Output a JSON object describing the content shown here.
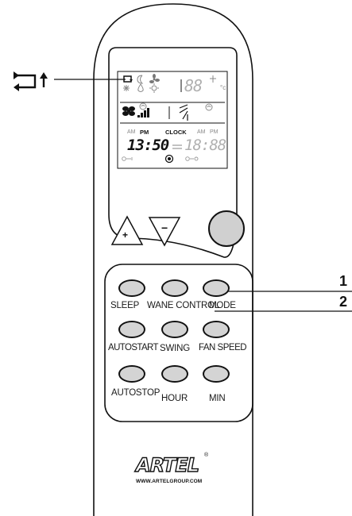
{
  "display": {
    "clock_label": "CLOCK",
    "am_left": "AM",
    "pm_left": "PM",
    "am_right": "AM",
    "pm_right": "PM",
    "clock_time": "13:50",
    "timer_time": "18:88",
    "temp_digits": "88",
    "degree_unit": "°c"
  },
  "buttons": {
    "up_symbol": "+",
    "down_symbol": "−",
    "row1": [
      "SLEEP",
      "WANE CONTROL",
      "MODE"
    ],
    "row2": [
      "AUTOSTART",
      "SWING",
      "FAN SPEED"
    ],
    "row3": [
      "AUTOSTOP",
      "HOUR",
      "MIN"
    ]
  },
  "callouts": [
    "1",
    "2"
  ],
  "brand": {
    "name": "ARTEL",
    "registered": "®",
    "url": "WWW.ARTELGROUP.COM"
  },
  "icons": [
    "mode-cycle-icon",
    "moon-icon",
    "fan-icon",
    "snowflake-icon",
    "drop-icon",
    "sun-icon",
    "swing-icon",
    "fan-speed-bars-icon",
    "louver-icon",
    "power-button-icon"
  ]
}
